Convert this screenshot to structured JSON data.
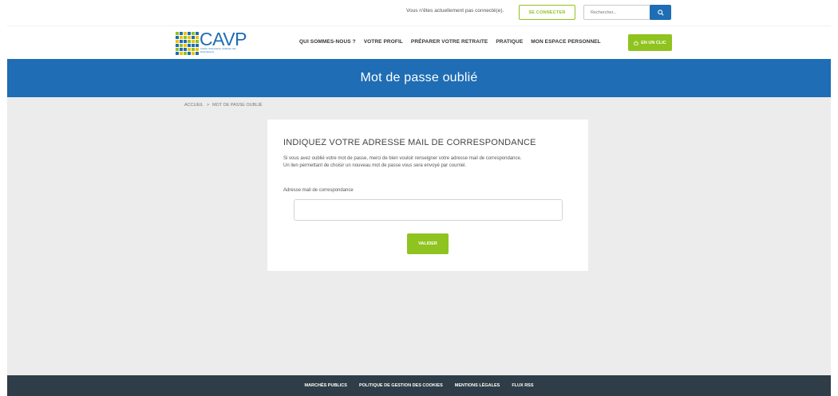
{
  "topbar": {
    "status_text": "Vous n'êtes actuellement pas connecté(e).",
    "connect_label": "SE CONNECTER",
    "search_placeholder": "Rechercher..."
  },
  "header": {
    "logo_text": "CAVP",
    "logo_tagline": "Caisse d'assurance vieillesse des pharmaciens",
    "nav": [
      "QUI SOMMES-NOUS ?",
      "VOTRE PROFIL",
      "PRÉPARER VOTRE RETRAITE",
      "PRATIQUE",
      "MON ESPACE PERSONNEL"
    ],
    "cta_label": "EN UN CLIC"
  },
  "banner": {
    "title": "Mot de passe oublié"
  },
  "breadcrumb": {
    "home": "ACCUEIL",
    "separator": ">",
    "current": "MOT DE PASSE OUBLIÉ"
  },
  "form": {
    "heading": "INDIQUEZ VOTRE ADRESSE MAIL DE CORRESPONDANCE",
    "desc_line1": "Si vous avez oublié votre mot de passe, merci de bien vouloir renseigner votre adresse mail de correspondance.",
    "desc_line2": "Un lien permettant de choisir un nouveau mot de passe vous sera envoyé par courriel.",
    "email_label": "Adresse mail de correspondance",
    "email_value": "",
    "submit_label": "VALIDER"
  },
  "footer": {
    "links": [
      "MARCHÉS PUBLICS",
      "POLITIQUE DE GESTION DES COOKIES",
      "MENTIONS LÉGALES",
      "FLUX RSS"
    ]
  },
  "colors": {
    "brand_blue": "#1f6db4",
    "accent_green": "#8fc31f",
    "footer_dark": "#2e3d47",
    "page_bg": "#ececec"
  },
  "icons": {
    "search": "search-icon",
    "cta": "power-icon"
  }
}
